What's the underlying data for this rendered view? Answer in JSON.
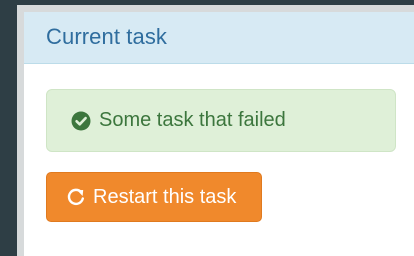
{
  "panel": {
    "title": "Current task"
  },
  "alert": {
    "icon": "check-circle-icon",
    "text": "Some task that failed",
    "color": "#3c763d",
    "background": "#dff0d8"
  },
  "restart_button": {
    "icon": "refresh-icon",
    "label": "Restart this task",
    "background": "#f0892c"
  }
}
